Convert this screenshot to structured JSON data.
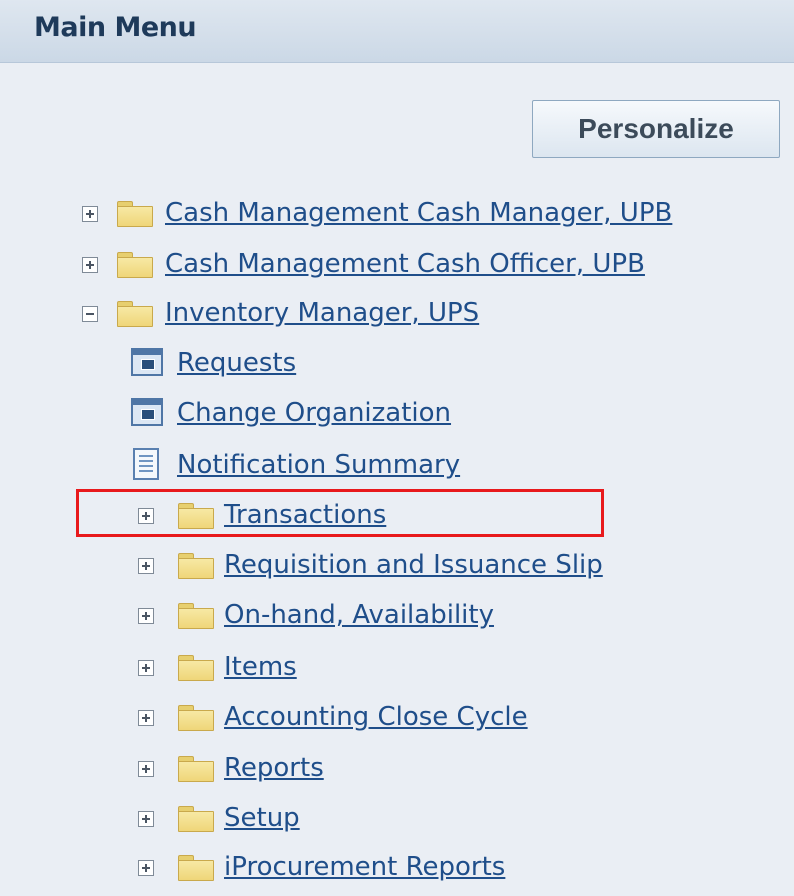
{
  "header": {
    "title": "Main Menu"
  },
  "toolbar": {
    "personalize_label": "Personalize"
  },
  "menu": {
    "top_items": [
      {
        "label": "Cash Management Cash Manager, UPB",
        "expanded": false,
        "icon": "folder-icon"
      },
      {
        "label": "Cash Management Cash Officer, UPB",
        "expanded": false,
        "icon": "folder-icon"
      },
      {
        "label": "Inventory Manager, UPS",
        "expanded": true,
        "icon": "folder-icon"
      }
    ],
    "functions": [
      {
        "label": "Requests",
        "icon": "function-window-icon"
      },
      {
        "label": "Change Organization",
        "icon": "function-window-icon"
      },
      {
        "label": "Notification Summary",
        "icon": "document-list-icon"
      }
    ],
    "sub_folders": [
      {
        "label": "Transactions",
        "expanded": false,
        "highlighted": true
      },
      {
        "label": "Requisition and Issuance Slip",
        "expanded": false
      },
      {
        "label": "On-hand, Availability",
        "expanded": false
      },
      {
        "label": "Items",
        "expanded": false
      },
      {
        "label": "Accounting Close Cycle",
        "expanded": false
      },
      {
        "label": "Reports",
        "expanded": false
      },
      {
        "label": "Setup",
        "expanded": false
      },
      {
        "label": "iProcurement Reports",
        "expanded": false
      }
    ]
  },
  "colors": {
    "link": "#1f4e8a",
    "highlight_box": "#e8191c",
    "page_background": "#eaeef4"
  }
}
